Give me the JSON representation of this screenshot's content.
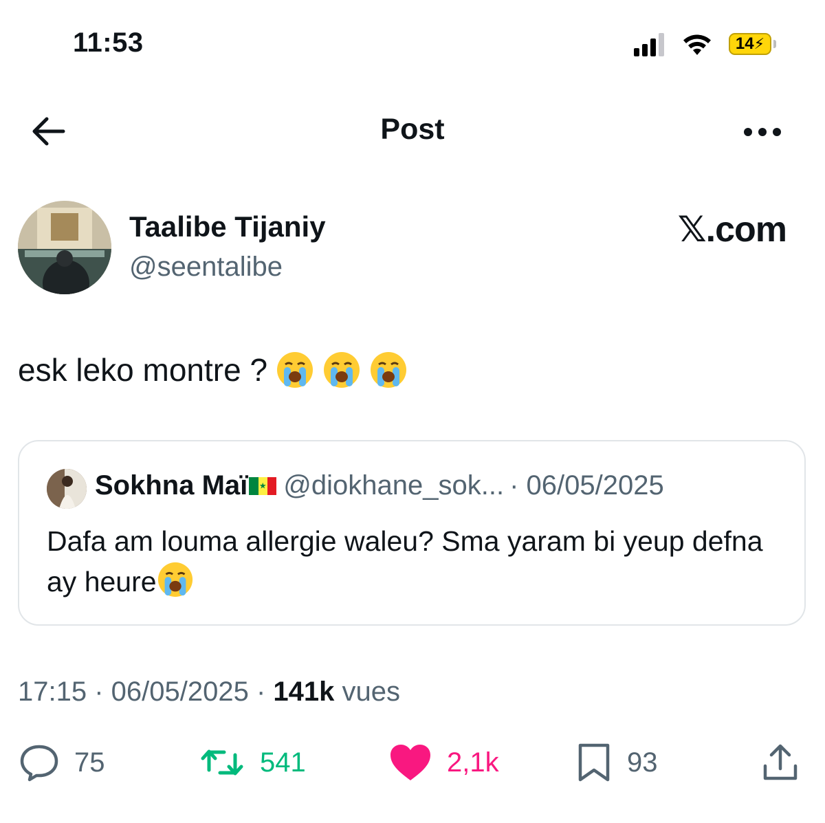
{
  "status_bar": {
    "time": "11:53",
    "battery": "14",
    "icons": [
      "signal-icon",
      "wifi-icon",
      "battery-charging-icon"
    ]
  },
  "header": {
    "title": "Post",
    "back_icon": "arrow-left-icon",
    "more_icon": "more-horizontal-icon"
  },
  "post": {
    "author_name": "Taalibe Tijaniy",
    "author_handle": "@seentalibe",
    "brand": "𝕏.com",
    "text": "esk leko montre ?",
    "text_emoji": "loudly-crying-face x3"
  },
  "quote": {
    "name": "Sokhna Maï",
    "flag": "senegal-flag",
    "handle": "@diokhane_sok...",
    "date": "· 06/05/2025",
    "text": "Dafa am louma allergie waleu? Sma yaram bi yeup defna ay heure"
  },
  "meta": {
    "time_date": "17:15 · 06/05/2025 · ",
    "views_count": "141k",
    "views_label": "vues"
  },
  "actions": {
    "replies": "75",
    "reposts": "541",
    "likes": "2,1k",
    "bookmarks": "93"
  },
  "colors": {
    "text": "#0f1419",
    "secondary": "#536471",
    "repost": "#00ba7c",
    "like": "#f91880",
    "border": "#e1e5e8",
    "battery": "#ffd60a"
  }
}
